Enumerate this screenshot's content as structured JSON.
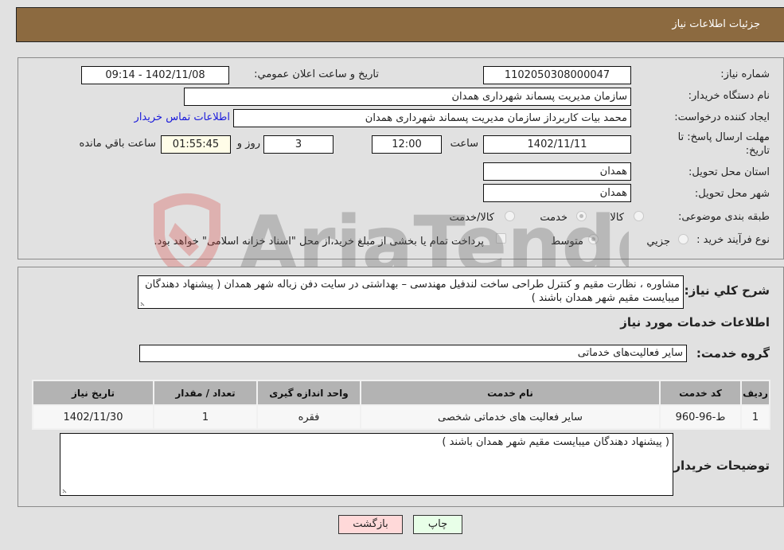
{
  "header": {
    "title": "جزئیات اطلاعات نیاز"
  },
  "form": {
    "need_number": {
      "label": "شماره نیاز:",
      "value": "1102050308000047"
    },
    "announce_datetime": {
      "label": "تاریخ و ساعت اعلان عمومي:",
      "value": "1402/11/08 - 09:14"
    },
    "buyer_org": {
      "label": "نام دستگاه خریدار:",
      "value": "سازمان مدیریت پسماند شهرداری همدان"
    },
    "requester": {
      "label": "ایجاد کننده درخواست:",
      "value": "محمد بیات کاربرداز سازمان مدیریت پسماند شهرداری همدان"
    },
    "buyer_contact_link": "اطلاعات تماس خریدار",
    "deadline": {
      "label_line1": "مهلت ارسال پاسخ: تا",
      "label_line2": "تاریخ:",
      "date": "1402/11/11",
      "time_label": "ساعت",
      "time": "12:00",
      "days": "3",
      "days_label": "روز و",
      "remaining": "01:55:45",
      "remaining_label": "ساعت باقي مانده"
    },
    "province": {
      "label": "استان محل تحویل:",
      "value": "همدان"
    },
    "city": {
      "label": "شهر محل تحویل:",
      "value": "همدان"
    },
    "category": {
      "label": "طبقه بندی موضوعی:",
      "options": [
        "کالا",
        "خدمت",
        "کالا/خدمت"
      ],
      "selected": "خدمت"
    },
    "purchase_type": {
      "label": "نوع فرآیند خرید :",
      "options": [
        "جزيي",
        "متوسط"
      ],
      "selected": "متوسط",
      "treasury_checkbox_label": "پرداخت تمام یا بخشی از مبلغ خرید،از محل \"اسناد خزانه اسلامی\" خواهد بود.",
      "treasury_checked": false
    }
  },
  "description": {
    "label": "شرح کلي نیاز:",
    "value": "مشاوره ، نظارت مقیم و کنترل طراحی ساخت لندفیل مهندسی – بهداشتی در سایت دفن زباله شهر همدان ( پیشنهاد دهندگان میبایست مقیم شهر همدان باشند )"
  },
  "services": {
    "section_title": "اطلاعات خدمات مورد نیاز",
    "group_label": "گروه خدمت:",
    "group_value": "سایر فعالیت‌های خدماتی",
    "columns": [
      "ردیف",
      "کد خدمت",
      "نام خدمت",
      "واحد اندازه گیری",
      "تعداد / مقدار",
      "تاریخ نیاز"
    ],
    "rows": [
      [
        "1",
        "ط-96-960",
        "سایر فعالیت های خدماتی شخصی",
        "فقره",
        "1",
        "1402/11/30"
      ]
    ]
  },
  "buyer_notes": {
    "label": "توضیحات خریدار:",
    "value": "( پیشنهاد دهندگان میبایست مقیم شهر همدان باشند )"
  },
  "buttons": {
    "print": "چاپ",
    "back": "بازگشت"
  },
  "watermark": {
    "text": "AriaTender.neT",
    "colors": {
      "shield": "#d9534f",
      "text": "#666666"
    }
  },
  "colors": {
    "header_bg": "#8c6a40",
    "page_bg": "#e1e1e1",
    "link": "#1a1adb",
    "back_btn": "#ffd9d9",
    "print_btn": "#e8ffe8",
    "remaining_bg": "#fffde8"
  }
}
